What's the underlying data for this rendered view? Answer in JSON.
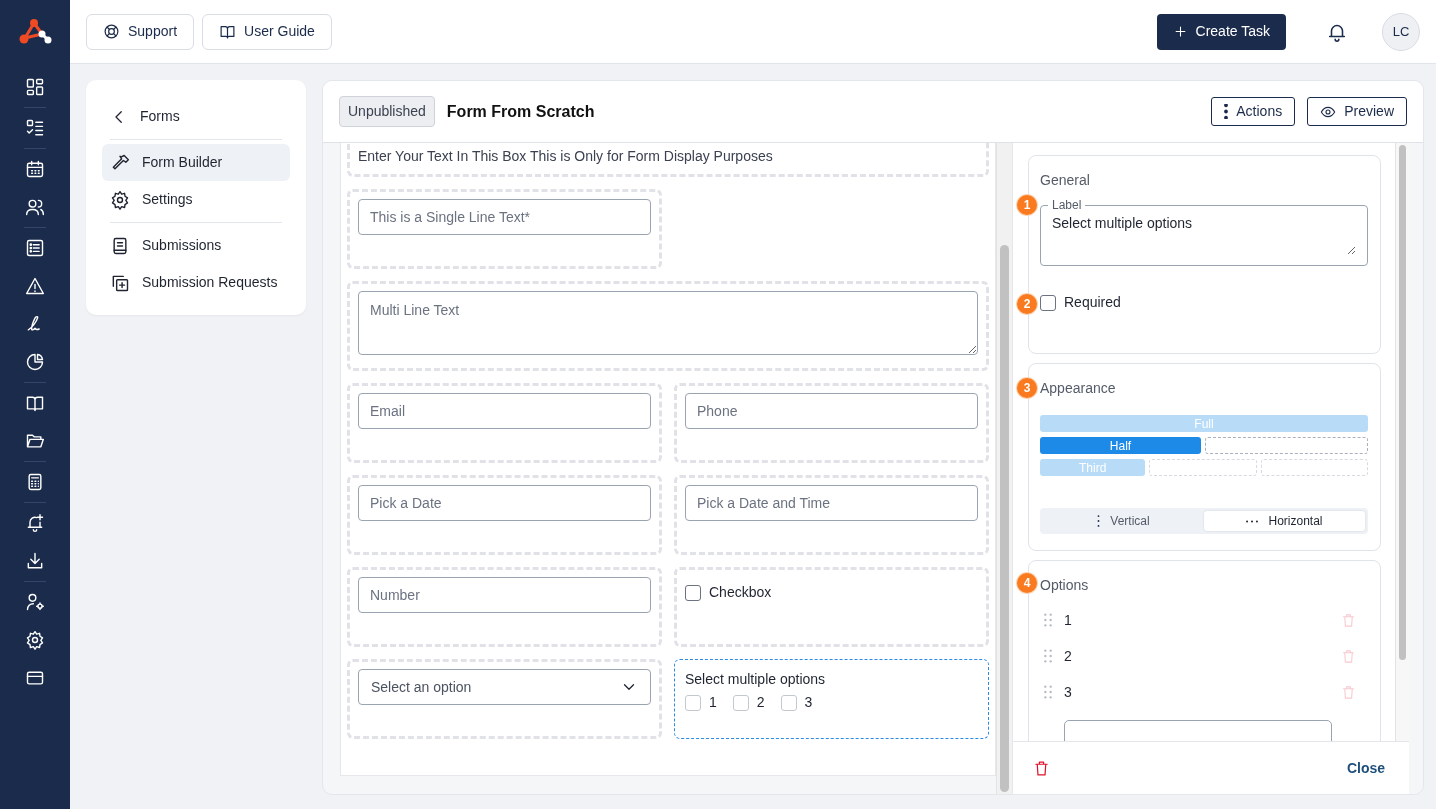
{
  "topbar": {
    "buttons": [
      {
        "label": "Support"
      },
      {
        "label": "User Guide"
      }
    ],
    "create_button": "Create Task",
    "avatar": "LC"
  },
  "form_nav": {
    "back": "Forms",
    "items": [
      {
        "label": "Form Builder",
        "selected": true
      },
      {
        "label": "Settings",
        "selected": false
      },
      {
        "label": "Submissions",
        "selected": false
      },
      {
        "label": "Submission Requests",
        "selected": false
      }
    ]
  },
  "header": {
    "status": "Unpublished",
    "title": "Form From Scratch",
    "actions": [
      "Actions",
      "Preview"
    ]
  },
  "canvas": {
    "fields": [
      {
        "kind": "text_block",
        "full_width": true,
        "text": "Enter Your Text In This Box This is Only for Form Display Purposes",
        "selected": false
      },
      {
        "kind": "input",
        "full_width": false,
        "placeholder": "This is a Single Line Text*",
        "selected": false
      },
      {
        "kind": "textarea",
        "full_width": true,
        "placeholder": "Multi Line Text",
        "selected": false
      },
      {
        "kind": "input",
        "full_width": false,
        "placeholder": "Email",
        "selected": false
      },
      {
        "kind": "input",
        "full_width": false,
        "placeholder": "Phone",
        "selected": false
      },
      {
        "kind": "input",
        "full_width": false,
        "placeholder": "Pick a Date",
        "selected": false
      },
      {
        "kind": "input",
        "full_width": false,
        "placeholder": "Pick a Date and Time",
        "selected": false
      },
      {
        "kind": "input",
        "full_width": false,
        "placeholder": "Number",
        "selected": false
      },
      {
        "kind": "checkbox",
        "full_width": false,
        "label": "Checkbox",
        "checked": false,
        "selected": false
      },
      {
        "kind": "select",
        "full_width": false,
        "placeholder": "Select an option",
        "selected": false
      },
      {
        "kind": "multi",
        "full_width": false,
        "label": "Select multiple options",
        "selected": true,
        "options": [
          {
            "label": "1",
            "checked": false
          },
          {
            "label": "2",
            "checked": false
          },
          {
            "label": "3",
            "checked": false
          }
        ]
      }
    ]
  },
  "properties": {
    "general": {
      "title": "General",
      "label_step": "1",
      "label_legend": "Label",
      "label_value": "Select multiple options",
      "required_step": "2",
      "required_label": "Required",
      "required": false
    },
    "appearance": {
      "step": "3",
      "title": "Appearance",
      "widths": [
        {
          "label": "Full",
          "selected": false
        },
        {
          "label": "Half",
          "selected": true
        },
        {
          "label": "Third",
          "selected": false
        }
      ],
      "orientations": [
        {
          "label": "Vertical",
          "selected": false
        },
        {
          "label": "Horizontal",
          "selected": true
        }
      ]
    },
    "options": {
      "step": "4",
      "title": "Options",
      "items": [
        {
          "label": "1"
        },
        {
          "label": "2"
        },
        {
          "label": "3"
        }
      ]
    }
  },
  "footer": {
    "close": "Close"
  }
}
